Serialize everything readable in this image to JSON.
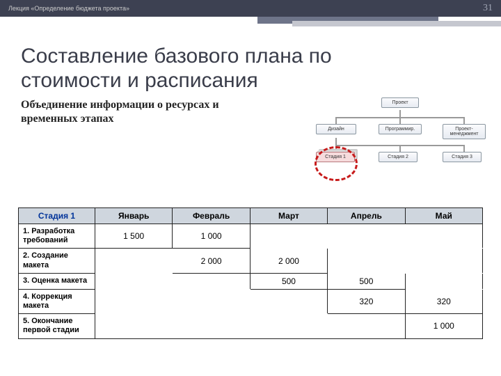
{
  "header": {
    "lecture": "Лекция «Определение бюджета проекта»",
    "page": "31"
  },
  "title_line1": "Составление базового плана по",
  "title_line2": "стоимости и расписания",
  "subtitle": "Объединение информации о ресурсах и временных этапах",
  "org": {
    "root": "Проект",
    "level2": [
      "Дизайн",
      "Программир.",
      "Проект-менеджмент"
    ],
    "level3": [
      "Стадия 1",
      "Стадия 2",
      "Стадия 3"
    ]
  },
  "chart_data": {
    "type": "table",
    "stage_header": "Стадия 1",
    "months": [
      "Январь",
      "Февраль",
      "Март",
      "Апрель",
      "Май"
    ],
    "rows": [
      {
        "name": "1. Разработка требований",
        "values": [
          "1 500",
          "1 000",
          "",
          "",
          ""
        ]
      },
      {
        "name": "2. Создание макета",
        "values": [
          "",
          "2 000",
          "2 000",
          "",
          ""
        ]
      },
      {
        "name": "3. Оценка макета",
        "values": [
          "",
          "",
          "500",
          "500",
          ""
        ]
      },
      {
        "name": "4. Коррекция макета",
        "values": [
          "",
          "",
          "",
          "320",
          "320"
        ]
      },
      {
        "name": "5. Окончание первой стадии",
        "values": [
          "",
          "",
          "",
          "",
          "1 000"
        ]
      }
    ]
  }
}
